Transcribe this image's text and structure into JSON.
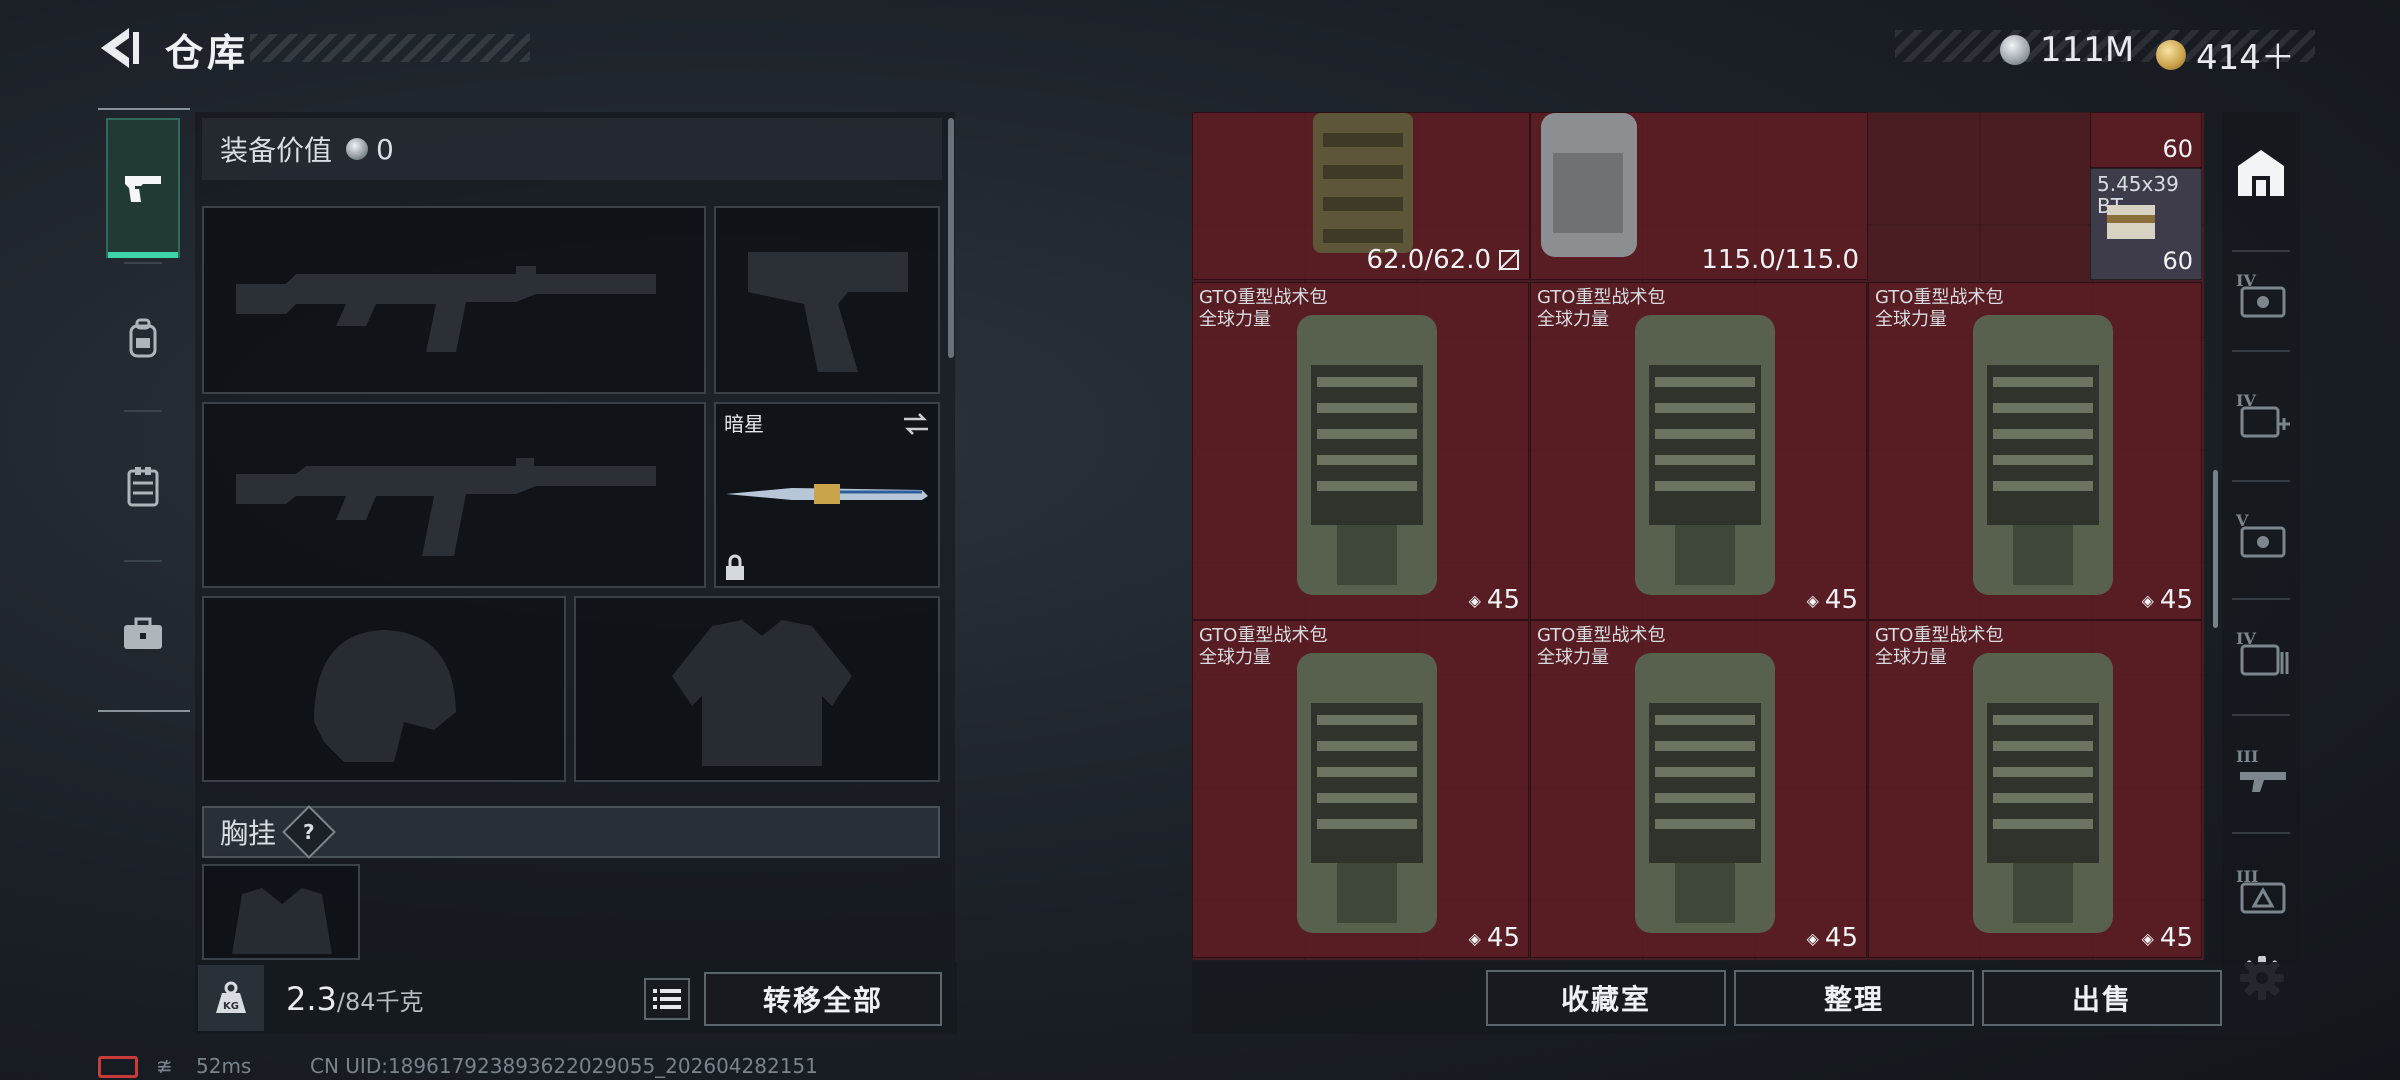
{
  "header": {
    "title": "仓库",
    "currencies": [
      {
        "icon": "silver-coin-icon",
        "value": "111M"
      },
      {
        "icon": "gold-coin-icon",
        "value": "414＋"
      }
    ]
  },
  "left_nav": {
    "items": [
      {
        "icon": "pistol-icon",
        "active": true
      },
      {
        "icon": "backpack-icon",
        "active": false
      },
      {
        "icon": "vest-icon",
        "active": false
      },
      {
        "icon": "briefcase-icon",
        "active": false
      }
    ]
  },
  "equipment": {
    "value_label": "装备价值",
    "value": "0",
    "slots": {
      "primary_weapon_1": {
        "icon": "rifle-icon"
      },
      "sidearm": {
        "icon": "pistol-icon"
      },
      "primary_weapon_2": {
        "icon": "rifle-icon"
      },
      "melee": {
        "name": "暗星",
        "icon": "knife-icon",
        "locked": true
      },
      "helmet": {
        "icon": "helmet-icon"
      },
      "armor": {
        "icon": "armor-icon"
      }
    },
    "chest_rig_label": "胸挂",
    "chest_rig_help": "?"
  },
  "weight": {
    "current": "2.3",
    "max": "/84千克",
    "icon_text": "KG"
  },
  "buttons": {
    "transfer_all": "转移全部",
    "collection": "收藏室",
    "organize": "整理",
    "sell": "出售"
  },
  "stash": {
    "top_items": [
      {
        "durability": "62.0/62.0",
        "icon": "camo-vest-icon"
      },
      {
        "durability": "115.0/115.0",
        "icon": "grey-vest-icon"
      }
    ],
    "ammo": [
      {
        "count": "60",
        "label": ""
      },
      {
        "count": "60",
        "label": "5.45x39\nBT"
      }
    ],
    "backpacks": [
      {
        "name": "GTO重型战术包\n全球力量",
        "capacity": "45"
      },
      {
        "name": "GTO重型战术包\n全球力量",
        "capacity": "45"
      },
      {
        "name": "GTO重型战术包\n全球力量",
        "capacity": "45"
      },
      {
        "name": "GTO重型战术包\n全球力量",
        "capacity": "45"
      },
      {
        "name": "GTO重型战术包\n全球力量",
        "capacity": "45"
      },
      {
        "name": "GTO重型战术包\n全球力量",
        "capacity": "45"
      }
    ]
  },
  "right_nav": {
    "items": [
      {
        "icon": "stash-home-icon"
      },
      {
        "icon": "tier4-case-icon",
        "tier": "IV"
      },
      {
        "icon": "tier4-medical-icon",
        "tier": "IV"
      },
      {
        "icon": "tier5-case-icon",
        "tier": "V"
      },
      {
        "icon": "tier4-ammo-case-icon",
        "tier": "IV"
      },
      {
        "icon": "tier3-weapon-case-icon",
        "tier": "III"
      },
      {
        "icon": "tier3-case-icon",
        "tier": "III"
      },
      {
        "icon": "settings-icon"
      }
    ]
  },
  "status_bar": {
    "ping": "52ms",
    "uid": "CN UID:18961792389362202905​5_202604282151"
  },
  "colors": {
    "accent": "#3fd4a8",
    "stash_bg": "#4a1d22",
    "panel_bg": "#12161b"
  }
}
